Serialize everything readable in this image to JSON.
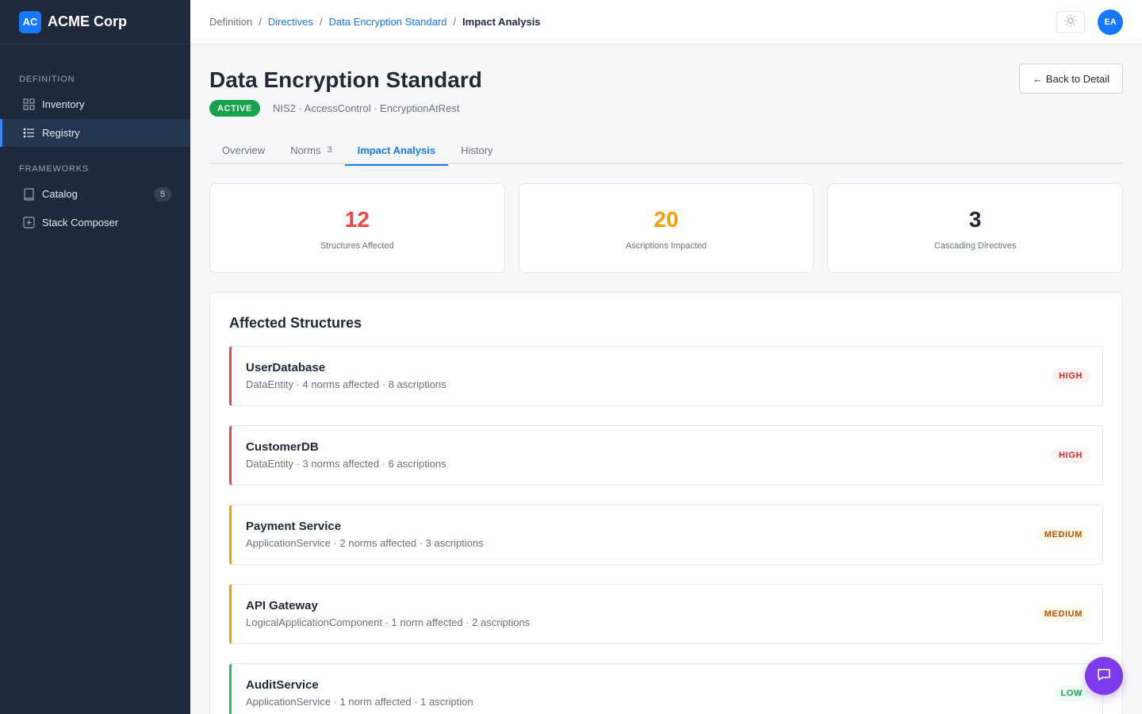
{
  "brand": {
    "logo_text": "AC",
    "name": "ACME Corp"
  },
  "sidebar": {
    "sections": [
      {
        "heading": "DEFINITION",
        "items": [
          {
            "label": "Inventory",
            "icon": "grid-icon"
          },
          {
            "label": "Registry",
            "icon": "list-icon",
            "active": true
          }
        ]
      },
      {
        "heading": "FRAMEWORKS",
        "items": [
          {
            "label": "Catalog",
            "icon": "book-icon",
            "badge": "5"
          },
          {
            "label": "Stack Composer",
            "icon": "plus-square-icon"
          }
        ]
      }
    ]
  },
  "breadcrumb": [
    "Definition",
    "Directives",
    "Data Encryption Standard",
    "Impact Analysis"
  ],
  "header": {
    "avatar_initials": "EA",
    "theme_icon": "sun-icon"
  },
  "page": {
    "title": "Data Encryption Standard",
    "status": "ACTIVE",
    "meta": "NIS2 · AccessControl · EncryptionAtRest",
    "back_button": "← Back to Detail"
  },
  "tabs": [
    {
      "label": "Overview"
    },
    {
      "label": "Norms",
      "count": "3"
    },
    {
      "label": "Impact Analysis",
      "active": true
    },
    {
      "label": "History"
    }
  ],
  "stats": [
    {
      "value": "12",
      "label": "Structures Affected",
      "color": "#ef4444"
    },
    {
      "value": "20",
      "label": "Ascriptions Impacted",
      "color": "#f59e0b"
    },
    {
      "value": "3",
      "label": "Cascading Directives",
      "color": "#1f2937"
    }
  ],
  "affected": {
    "title": "Affected Structures",
    "items": [
      {
        "name": "UserDatabase",
        "meta": "DataEntity · 4 norms affected · 8 ascriptions",
        "severity": "HIGH"
      },
      {
        "name": "CustomerDB",
        "meta": "DataEntity · 3 norms affected · 6 ascriptions",
        "severity": "HIGH"
      },
      {
        "name": "Payment Service",
        "meta": "ApplicationService · 2 norms affected · 3 ascriptions",
        "severity": "MEDIUM"
      },
      {
        "name": "API Gateway",
        "meta": "LogicalApplicationComponent · 1 norm affected · 2 ascriptions",
        "severity": "MEDIUM"
      },
      {
        "name": "AuditService",
        "meta": "ApplicationService · 1 norm affected · 1 ascription",
        "severity": "LOW"
      }
    ]
  },
  "colors": {
    "accent": "#1677ff",
    "sidebar_bg": "#1e293b",
    "fab": "#7c3aed"
  }
}
